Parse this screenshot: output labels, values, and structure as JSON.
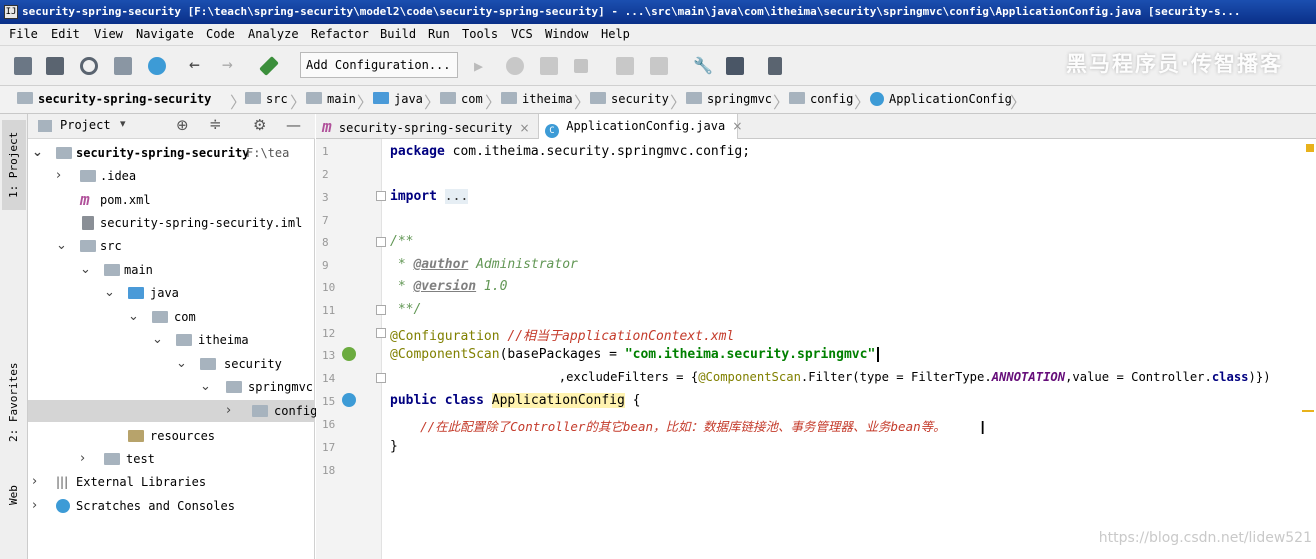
{
  "window": {
    "title": "security-spring-security [F:\\teach\\spring-security\\model2\\code\\security-spring-security] - ...\\src\\main\\java\\com\\itheima\\security\\springmvc\\config\\ApplicationConfig.java [security-s..."
  },
  "menu": [
    "File",
    "Edit",
    "View",
    "Navigate",
    "Code",
    "Analyze",
    "Refactor",
    "Build",
    "Run",
    "Tools",
    "VCS",
    "Window",
    "Help"
  ],
  "toolbar": {
    "run_config": "Add Configuration...",
    "watermark": "黑马程序员·传智播客"
  },
  "breadcrumb": [
    "security-spring-security",
    "src",
    "main",
    "java",
    "com",
    "itheima",
    "security",
    "springmvc",
    "config",
    "ApplicationConfig"
  ],
  "left_strip": {
    "project_tab": "1: Project",
    "favorites_tab": "2: Favorites",
    "web_tab": "Web"
  },
  "project_panel": {
    "view_label": "Project",
    "tree": [
      {
        "label": "security-spring-security",
        "extra": "F:\\tea"
      },
      {
        "label": ".idea"
      },
      {
        "label": "pom.xml"
      },
      {
        "label": "security-spring-security.iml"
      },
      {
        "label": "src"
      },
      {
        "label": "main"
      },
      {
        "label": "java"
      },
      {
        "label": "com"
      },
      {
        "label": "itheima"
      },
      {
        "label": "security"
      },
      {
        "label": "springmvc"
      },
      {
        "label": "config"
      },
      {
        "label": "resources"
      },
      {
        "label": "test"
      },
      {
        "label": "External Libraries"
      },
      {
        "label": "Scratches and Consoles"
      }
    ]
  },
  "editor": {
    "tabs": [
      "security-spring-security",
      "ApplicationConfig.java"
    ],
    "line_numbers": [
      "1",
      "2",
      "3",
      "7",
      "8",
      "9",
      "10",
      "11",
      "12",
      "13",
      "14",
      "15",
      "16",
      "17",
      "18"
    ],
    "code": {
      "l1_kw": "package",
      "l1_rest": " com.itheima.security.springmvc.config;",
      "l3_kw": "import",
      "l3_fold": "...",
      "l8": "/**",
      "l9_star": " * ",
      "l9_tag": "@author",
      "l9_val": " Administrator",
      "l10_star": " * ",
      "l10_tag": "@version",
      "l10_val": " 1.0",
      "l11": " **/",
      "l12_ann": "@Configuration",
      "l12_cm": " //相当于applicationContext.xml",
      "l13_ann": "@ComponentScan",
      "l13_mid": "(basePackages = ",
      "l13_str": "\"com.itheima.security.springmvc\"",
      "l14_a": "                       ,excludeFilters = {",
      "l14_ann": "@ComponentScan",
      "l14_b": ".Filter(type = FilterType.",
      "l14_const": "ANNOTATION",
      "l14_c": ",value = Controller.",
      "l14_kw": "class",
      "l14_d": ")})",
      "l15_kw": "public class",
      "l15_sp": " ",
      "l15_name": "ApplicationConfig",
      "l15_end": " {",
      "l16": "    //在此配置除了Controller的其它bean，比如：数据库链接池、事务管理器、业务bean等。",
      "l17": "}"
    }
  },
  "watermark": "https://blog.csdn.net/lidew521",
  "colors": {
    "titlebar": "#0a2f88",
    "keyword": "#000080",
    "string": "#008000",
    "annotation": "#808000",
    "comment_red": "#c43b2b"
  }
}
